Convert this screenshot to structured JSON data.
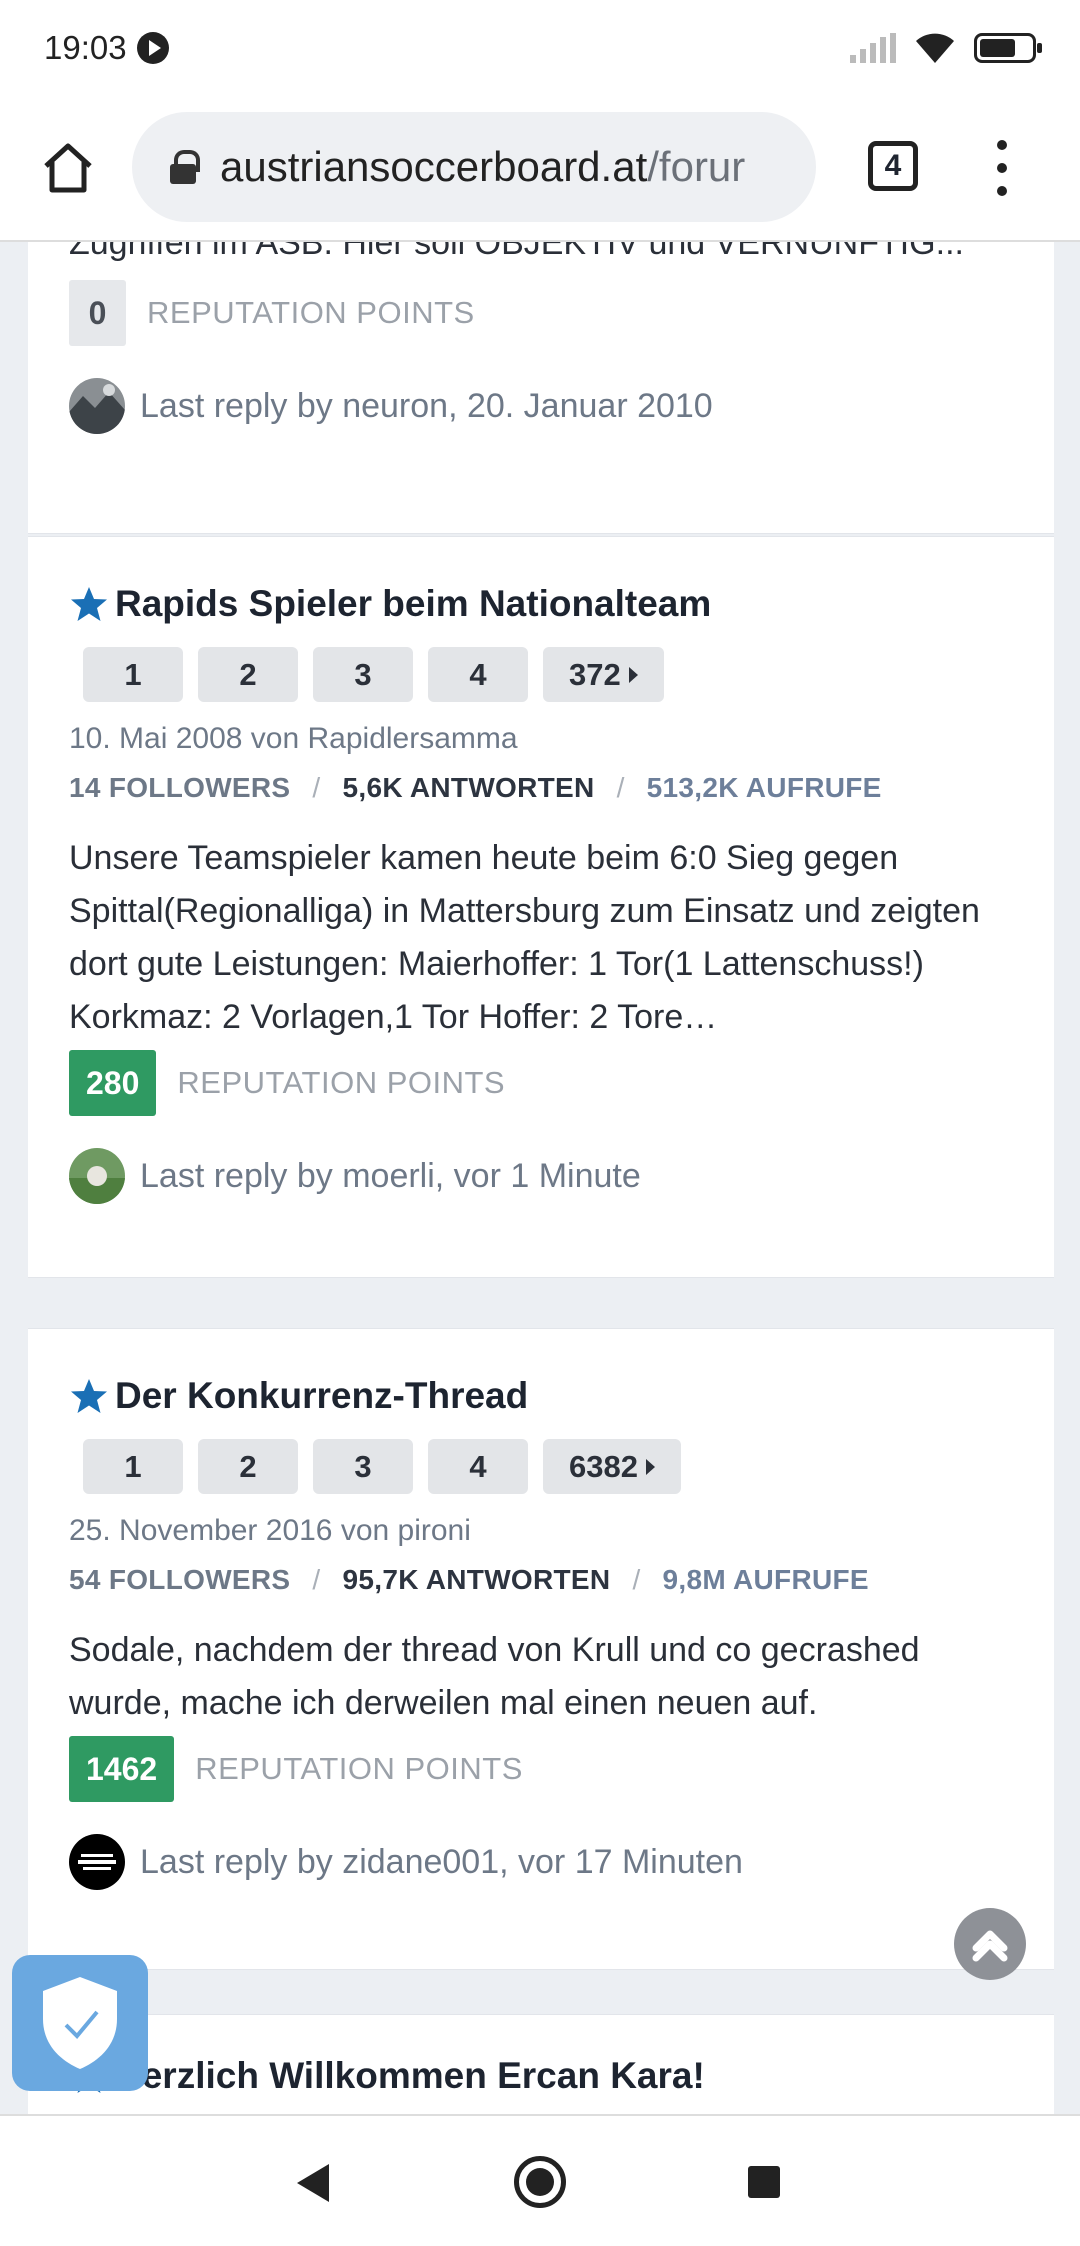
{
  "status_bar": {
    "time": "19:03"
  },
  "browser": {
    "url_host": "austriansoccerboard.at",
    "url_path": "/forur",
    "tab_count": "4"
  },
  "top_snippet": {
    "text": "Zugriffen im ASB. Hier soll OBJEKTIV und VERNÜNFTIG...",
    "reputation": "0",
    "reputation_label": "REPUTATION POINTS",
    "last_reply": "Last reply by neuron, 20. Januar 2010"
  },
  "threads": [
    {
      "title": "Rapids Spieler beim Nationalteam",
      "pages": [
        "1",
        "2",
        "3",
        "4",
        "372"
      ],
      "meta": "10. Mai 2008 von Rapidlersamma",
      "followers": "14 FOLLOWERS",
      "answers": "5,6K ANTWORTEN",
      "views": "513,2K AUFRUFE",
      "body": "Unsere Teamspieler kamen heute beim 6:0 Sieg gegen Spittal(Regionalliga) in Mattersburg zum Einsatz und zeigten dort gute Leistungen: Maierhoffer: 1 Tor(1 Lattenschuss!) Korkmaz: 2 Vorlagen,1 Tor Hoffer: 2 Tore…",
      "reputation": "280",
      "reputation_label": "REPUTATION POINTS",
      "last_reply": "Last reply by moerli, vor 1 Minute"
    },
    {
      "title": "Der Konkurrenz-Thread",
      "pages": [
        "1",
        "2",
        "3",
        "4",
        "6382"
      ],
      "meta": "25. November 2016 von pironi",
      "followers": "54 FOLLOWERS",
      "answers": "95,7K ANTWORTEN",
      "views": "9,8M AUFRUFE",
      "body": "Sodale, nachdem der thread von Krull und co gecrashed wurde, mache ich derweilen mal einen neuen auf.",
      "reputation": "1462",
      "reputation_label": "REPUTATION POINTS",
      "last_reply": "Last reply by zidane001, vor 17 Minuten"
    },
    {
      "title": "Herzlich Willkommen Ercan Kara!"
    }
  ],
  "colors": {
    "accent_star": "#1a6fb5",
    "reputation_positive": "#2f9a62",
    "shield": "#6aa8e0"
  },
  "icons": [
    "home-icon",
    "lock-icon",
    "tabs-icon",
    "menu-icon",
    "star-icon",
    "scroll-top-icon",
    "shield-check-icon",
    "back-icon",
    "home-nav-icon",
    "recents-icon"
  ]
}
